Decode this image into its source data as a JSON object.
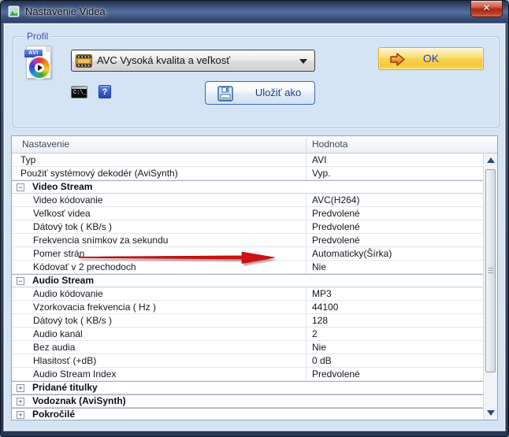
{
  "window": {
    "title": "Nastavenie Videa",
    "close_glyph": "✕"
  },
  "profile": {
    "group_label": "Profil",
    "dropdown_value": "AVC Vysoká kvalita a veľkosť",
    "ok_label": "OK",
    "save_as_label": "Uložiť ako",
    "avi_badge": "AVI",
    "cmd_icon_text": "C:\\_",
    "help_glyph": "?"
  },
  "icons": {
    "collapse_glyph": "−",
    "expand_glyph": "+"
  },
  "colors": {
    "dialog_background": "#d5e4f4",
    "ok_button_gold": "#f6ca3c",
    "annotation_arrow_red": "#d01212",
    "title_bar_blue": "#3a5078",
    "close_button_red": "#a52718"
  },
  "annotation": {
    "arrow_points_to": "Pomer strán"
  },
  "table": {
    "columns": [
      "Nastavenie",
      "Hodnota"
    ],
    "rows": [
      {
        "type": "item",
        "level": 0,
        "label": "Typ",
        "value": "AVI"
      },
      {
        "type": "item",
        "level": 0,
        "label": "Použiť systémový dekodér (AviSynth)",
        "value": "Vyp."
      },
      {
        "type": "group",
        "expanded": true,
        "label": "Video Stream"
      },
      {
        "type": "item",
        "level": 1,
        "label": "Video kódovanie",
        "value": "AVC(H264)"
      },
      {
        "type": "item",
        "level": 1,
        "label": "Veľkosť videa",
        "value": "Predvolené"
      },
      {
        "type": "item",
        "level": 1,
        "label": "Dátový tok ( KB/s )",
        "value": "Predvolené"
      },
      {
        "type": "item",
        "level": 1,
        "label": "Frekvencia snímkov za sekundu",
        "value": "Predvolené"
      },
      {
        "type": "item",
        "level": 1,
        "label": "Pomer strán",
        "value": "Automaticky(Šírka)"
      },
      {
        "type": "item",
        "level": 1,
        "label": "Kódovať v 2 prechodoch",
        "value": "Nie"
      },
      {
        "type": "group",
        "expanded": true,
        "label": "Audio Stream"
      },
      {
        "type": "item",
        "level": 1,
        "label": "Audio kódovanie",
        "value": "MP3"
      },
      {
        "type": "item",
        "level": 1,
        "label": "Vzorkovacia frekvencia ( Hz )",
        "value": "44100"
      },
      {
        "type": "item",
        "level": 1,
        "label": "Dátový tok ( KB/s )",
        "value": "128"
      },
      {
        "type": "item",
        "level": 1,
        "label": "Audio kanál",
        "value": "2"
      },
      {
        "type": "item",
        "level": 1,
        "label": "Bez audia",
        "value": "Nie"
      },
      {
        "type": "item",
        "level": 1,
        "label": "Hlasitosť (+dB)",
        "value": "0 dB"
      },
      {
        "type": "item",
        "level": 1,
        "label": "Audio Stream Index",
        "value": "Predvolené"
      },
      {
        "type": "group",
        "expanded": false,
        "label": "Pridané titulky"
      },
      {
        "type": "group",
        "expanded": false,
        "label": "Vodoznak (AviSynth)"
      },
      {
        "type": "group",
        "expanded": false,
        "label": "Pokročilé"
      }
    ]
  }
}
